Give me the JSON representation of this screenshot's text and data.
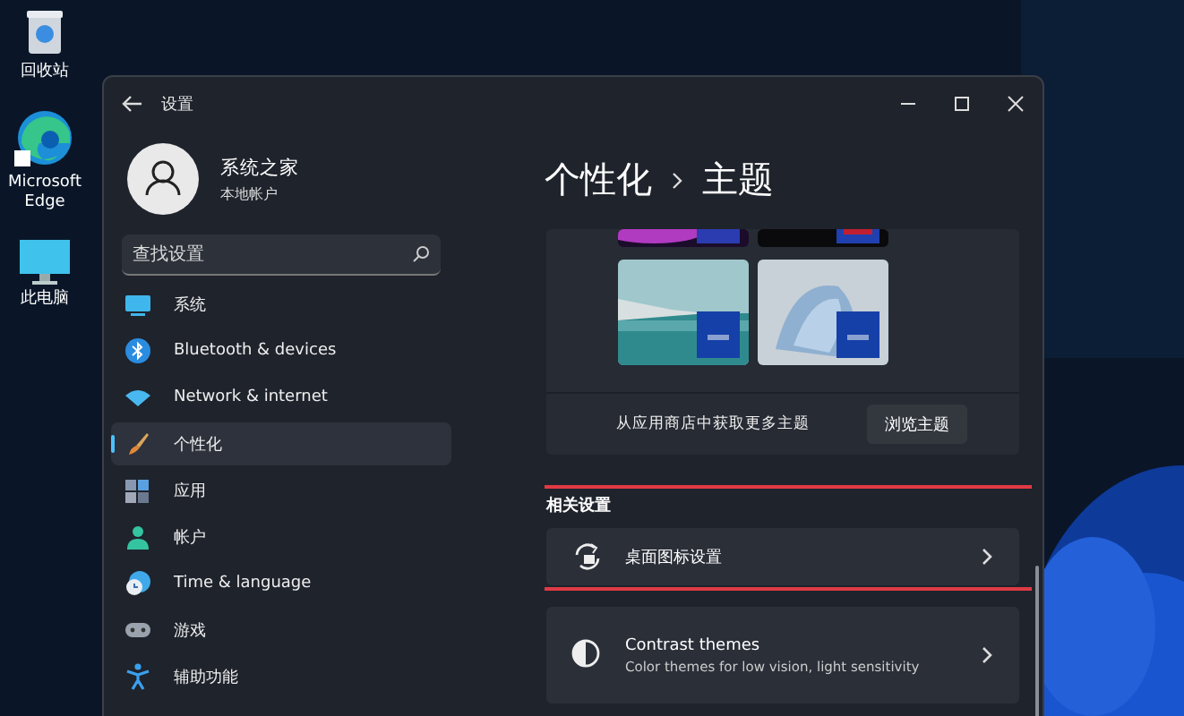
{
  "desktop_icons": [
    {
      "kind": "recycle",
      "label": "回收站"
    },
    {
      "kind": "edge",
      "label": "Microsoft Edge"
    },
    {
      "kind": "pc",
      "label": "此电脑"
    }
  ],
  "window": {
    "title": "设置"
  },
  "account": {
    "name": "系统之家",
    "type": "本地帐户"
  },
  "search": {
    "placeholder": "查找设置"
  },
  "nav_items": [
    {
      "label": "系统",
      "selected": false
    },
    {
      "label": "Bluetooth & devices",
      "selected": false
    },
    {
      "label": "Network & internet",
      "selected": false
    },
    {
      "label": "个性化",
      "selected": true
    },
    {
      "label": "应用",
      "selected": false
    },
    {
      "label": "帐户",
      "selected": false
    },
    {
      "label": "Time & language",
      "selected": false
    },
    {
      "label": "游戏",
      "selected": false
    },
    {
      "label": "辅助功能",
      "selected": false
    }
  ],
  "breadcrumb": [
    "个性化",
    "主题"
  ],
  "theme_thumbnails": [
    {
      "kind": "picture"
    },
    {
      "kind": "picture"
    },
    {
      "kind": "picture"
    },
    {
      "kind": "picture"
    }
  ],
  "store": {
    "text": "从应用商店中获取更多主题",
    "button": "浏览主题"
  },
  "related_settings": {
    "title": "相关设置",
    "highlighted": true,
    "items": [
      {
        "title": "桌面图标设置"
      },
      {
        "title": "Contrast themes",
        "subtitle": "Color themes for low vision, light sensitivity"
      }
    ]
  }
}
